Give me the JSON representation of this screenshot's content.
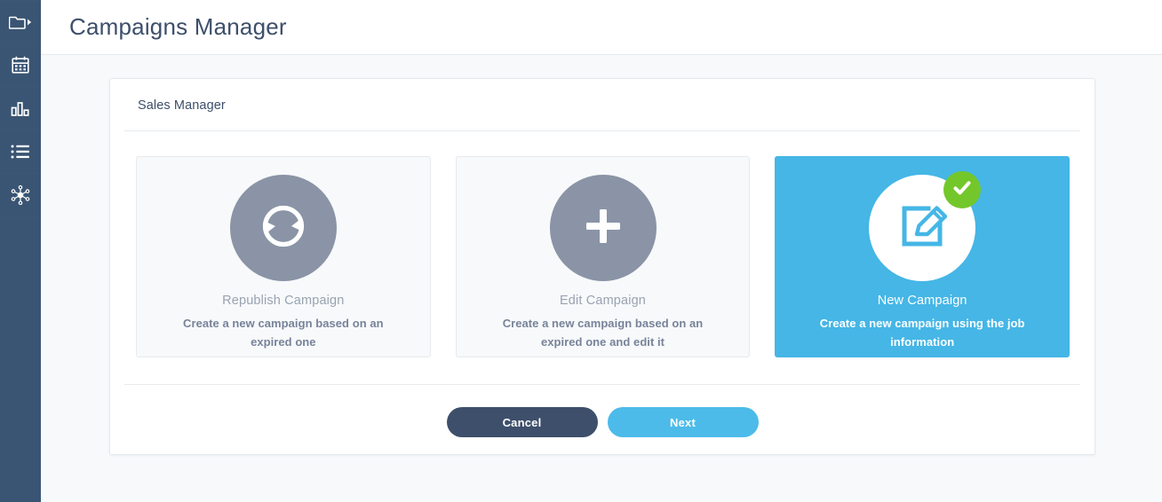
{
  "sidebar": {
    "items": [
      {
        "name": "campaigns-folder",
        "icon": "folder-play-icon",
        "active": true
      },
      {
        "name": "calendar",
        "icon": "calendar-icon",
        "active": false
      },
      {
        "name": "reports",
        "icon": "bar-chart-icon",
        "active": false
      },
      {
        "name": "lists",
        "icon": "list-icon",
        "active": false
      },
      {
        "name": "integrations",
        "icon": "network-hub-icon",
        "active": false
      }
    ]
  },
  "header": {
    "title": "Campaigns Manager"
  },
  "panel": {
    "title": "Sales Manager",
    "cards": [
      {
        "id": "republish-campaign",
        "icon": "refresh-icon",
        "name": "Republish Campaign",
        "description": "Create a new campaign based on an expired one",
        "selected": false
      },
      {
        "id": "edit-campaign",
        "icon": "plus-icon",
        "name": "Edit Campaign",
        "description": "Create a new campaign based on an expired one and edit it",
        "selected": false
      },
      {
        "id": "new-campaign",
        "icon": "edit-square-icon",
        "name": "New Campaign",
        "description": "Create a new campaign using the job information",
        "selected": true,
        "badge": "check-icon"
      }
    ]
  },
  "actions": {
    "cancel_label": "Cancel",
    "next_label": "Next"
  },
  "colors": {
    "sidebar": "#3a5573",
    "accent_blue": "#45b6e6",
    "next_button": "#4cbbe9",
    "cancel_button": "#3d4f6b",
    "badge_green": "#74c72b",
    "icon_circle_gray": "#8a94a6",
    "page_background": "#f7f9fb",
    "title_text": "#3d4f6b"
  }
}
